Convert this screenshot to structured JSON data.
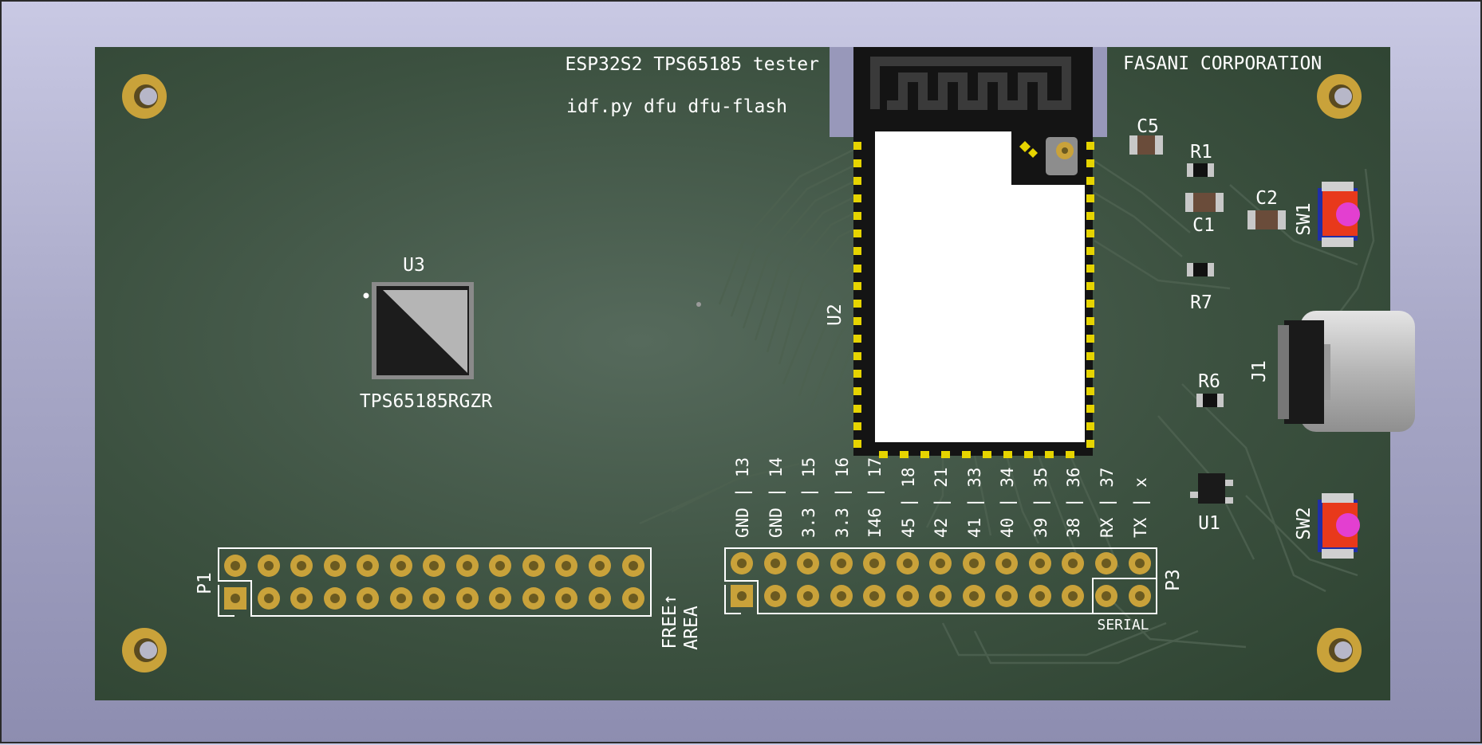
{
  "board": {
    "title": "ESP32S2 TPS65185 tester",
    "command": "idf.py dfu dfu-flash",
    "company": "FASANI CORPORATION"
  },
  "components": {
    "u3": "U3",
    "u3_part": "TPS65185RGZR",
    "u2": "U2",
    "c5": "C5",
    "r1": "R1",
    "c1": "C1",
    "c2": "C2",
    "sw1": "SW1",
    "r7": "R7",
    "r6": "R6",
    "j1": "J1",
    "u1": "U1",
    "sw2": "SW2",
    "p1": "P1",
    "p3": "P3",
    "free_1": "FREE↑",
    "free_2": "AREA",
    "serial": "SERIAL"
  },
  "p3_pins": [
    "GND | 13",
    "GND | 14",
    "3.3 | 15",
    "3.3 | 16",
    "I46 | 17",
    "45 | 18",
    "42 | 21",
    "41 | 33",
    "40 | 34",
    "39 | 35",
    "38 | 36",
    "RX | 37",
    "TX | x"
  ],
  "colors": {
    "pcb": "#3f5444",
    "copper": "#c9a23a",
    "silk": "#ffffff",
    "button": "#e8391b"
  }
}
